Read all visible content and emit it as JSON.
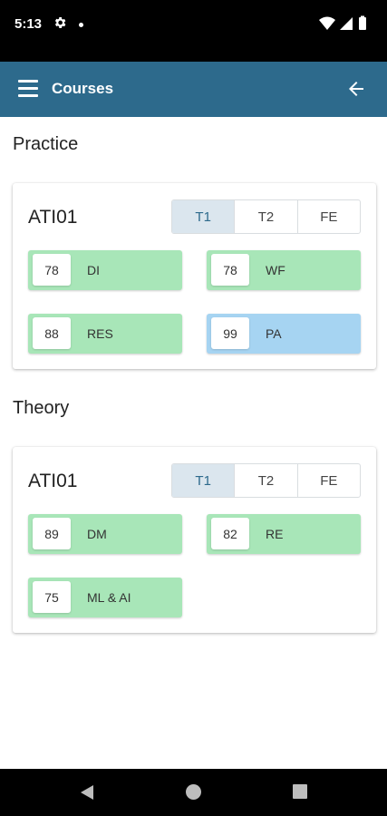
{
  "status_bar": {
    "time": "5:13",
    "icons": [
      "gear-icon",
      "notification-dot-icon",
      "wifi-icon",
      "cellular-icon",
      "battery-icon"
    ]
  },
  "app_bar": {
    "title": "Courses",
    "background": "#2d6a8c",
    "icons": [
      "menu-icon",
      "arrow-back-icon"
    ]
  },
  "sections": [
    {
      "title": "Practice",
      "course": "ATI01",
      "tabs": [
        "T1",
        "T2",
        "FE"
      ],
      "selected_tab": "T1",
      "items": [
        {
          "score": "78",
          "label": "DI",
          "color": "#a8e6b8"
        },
        {
          "score": "78",
          "label": "WF",
          "color": "#a8e6b8"
        },
        {
          "score": "88",
          "label": "RES",
          "color": "#a8e6b8"
        },
        {
          "score": "99",
          "label": "PA",
          "color": "#a6d4f2"
        }
      ]
    },
    {
      "title": "Theory",
      "course": "ATI01",
      "tabs": [
        "T1",
        "T2",
        "FE"
      ],
      "selected_tab": "T1",
      "items": [
        {
          "score": "89",
          "label": "DM",
          "color": "#a8e6b8"
        },
        {
          "score": "82",
          "label": "RE",
          "color": "#a8e6b8"
        },
        {
          "score": "75",
          "label": "ML & AI",
          "color": "#a8e6b8"
        }
      ]
    }
  ],
  "nav_bar": {
    "icons": [
      "nav-back-icon",
      "nav-home-icon",
      "nav-recents-icon"
    ]
  }
}
